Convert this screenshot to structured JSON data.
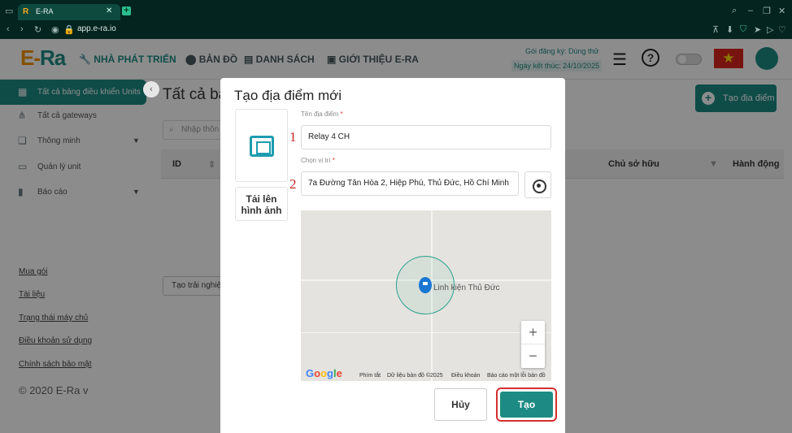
{
  "browser": {
    "tab_title": "E-RA",
    "tab_favicon": "R",
    "url": "app.e-ra.io"
  },
  "header": {
    "logo_e": "E-",
    "logo_ra": "Ra",
    "nav": [
      {
        "label": "NHÀ PHÁT TRIỂN",
        "icon": "wrench-icon"
      },
      {
        "label": "BẢN ĐỒ",
        "icon": "pin-icon"
      },
      {
        "label": "DANH SÁCH",
        "icon": "list-icon"
      },
      {
        "label": "GIỚI THIỆU E-RA",
        "icon": "info-icon"
      }
    ],
    "plan_label": "Gói đăng ký: Dùng thử",
    "plan_end": "Ngày kết thúc: 24/10/2025",
    "flag_symbol": "★"
  },
  "sidebar": {
    "items": [
      {
        "label": "Tất cả bảng điều khiển Units",
        "icon": "units-icon"
      },
      {
        "label": "Tất cả gateways",
        "icon": "gateway-icon"
      },
      {
        "label": "Thông minh",
        "icon": "smart-icon"
      },
      {
        "label": "Quản lý unit",
        "icon": "unit-manage-icon"
      },
      {
        "label": "Báo cáo",
        "icon": "report-icon"
      }
    ],
    "links": [
      "Mua gói",
      "Tài liệu",
      "Trạng thái máy chủ",
      "Điều khoản sử dụng",
      "Chính sách bảo mật"
    ],
    "copyright": "© 2020 E-Ra v"
  },
  "main": {
    "title": "Tất cả ba",
    "create_label": "Tạo địa điểm",
    "search_placeholder": "Nhập thôn",
    "columns": {
      "id": "ID",
      "owner": "Chủ sở hữu",
      "action": "Hành động"
    },
    "demo_label": "Tạo trải nghiệm"
  },
  "modal": {
    "title": "Tạo địa điểm mới",
    "upload_label": "Tải lên hình ảnh",
    "name_label": "Tên địa điểm",
    "name_value": "Relay 4 CH",
    "location_label": "Chọn vị trí",
    "location_value": "7a Đường Tân Hòa 2, Hiệp Phú, Thủ Đức, Hồ Chí Minh",
    "required_mark": "*",
    "marker_1": "1",
    "marker_2": "2",
    "map": {
      "place_label": "Linh kiện Thủ Đức",
      "zoom_in": "+",
      "zoom_out": "−",
      "google": "Google",
      "attributions": [
        "Phím tắt",
        "Dữ liệu bản đồ ©2025",
        "Điều khoản",
        "Báo cáo một lỗi bản đồ"
      ]
    },
    "cancel_label": "Hủy",
    "submit_label": "Tạo"
  },
  "colors": {
    "brand": "#1d8b84",
    "logo_orange": "#f39200",
    "highlight": "#d32f2f"
  }
}
